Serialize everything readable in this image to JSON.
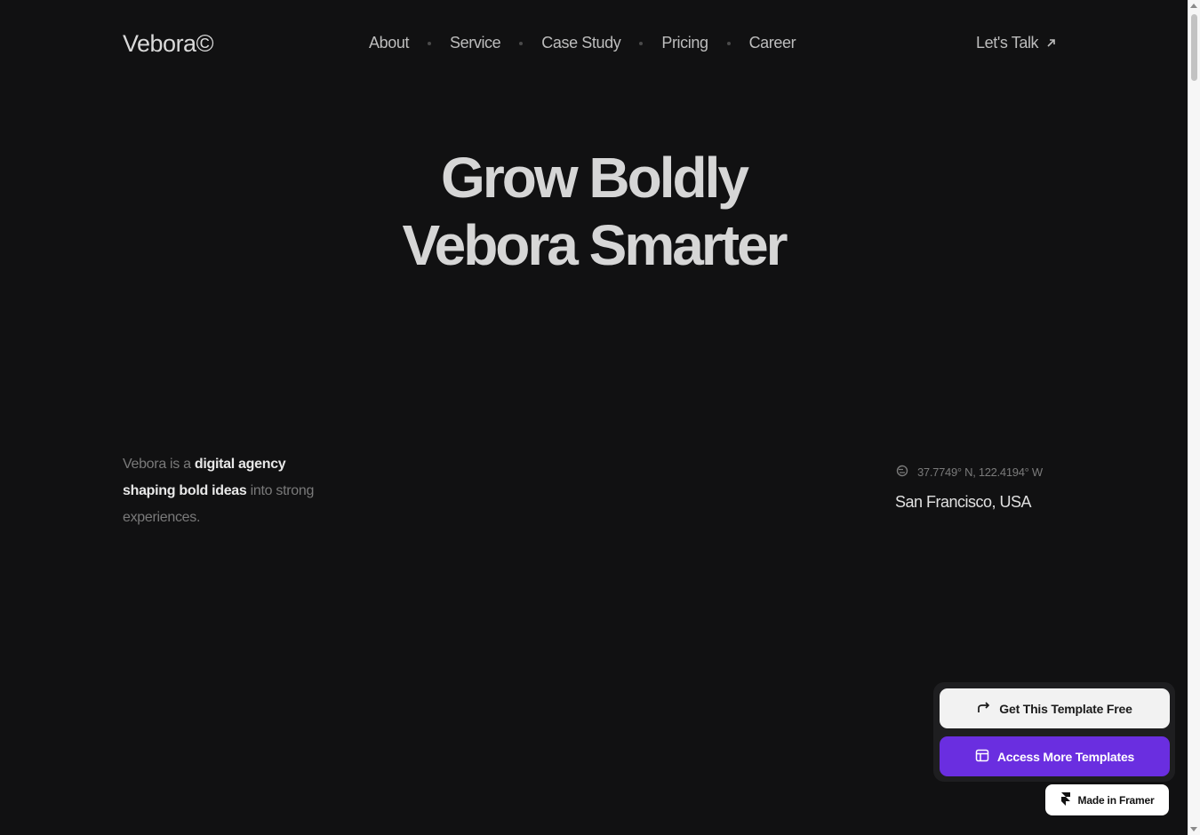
{
  "header": {
    "logo": "Vebora©",
    "nav": [
      "About",
      "Service",
      "Case Study",
      "Pricing",
      "Career"
    ],
    "cta": "Let's Talk"
  },
  "hero": {
    "line1": "Grow Boldly",
    "line2": "Vebora Smarter"
  },
  "intro": {
    "part1": "Vebora is a ",
    "highlight1": "digital agency",
    "highlight2": "shaping bold ideas",
    "part2": " into strong experiences."
  },
  "location": {
    "coords": "37.7749° N, 122.4194° W",
    "city": "San Francisco, USA"
  },
  "floating": {
    "get_template": "Get This Template Free",
    "access_more": "Access More Templates",
    "made_in": "Made in Framer"
  },
  "colors": {
    "background": "#111112",
    "accent": "#6a2ee0"
  }
}
